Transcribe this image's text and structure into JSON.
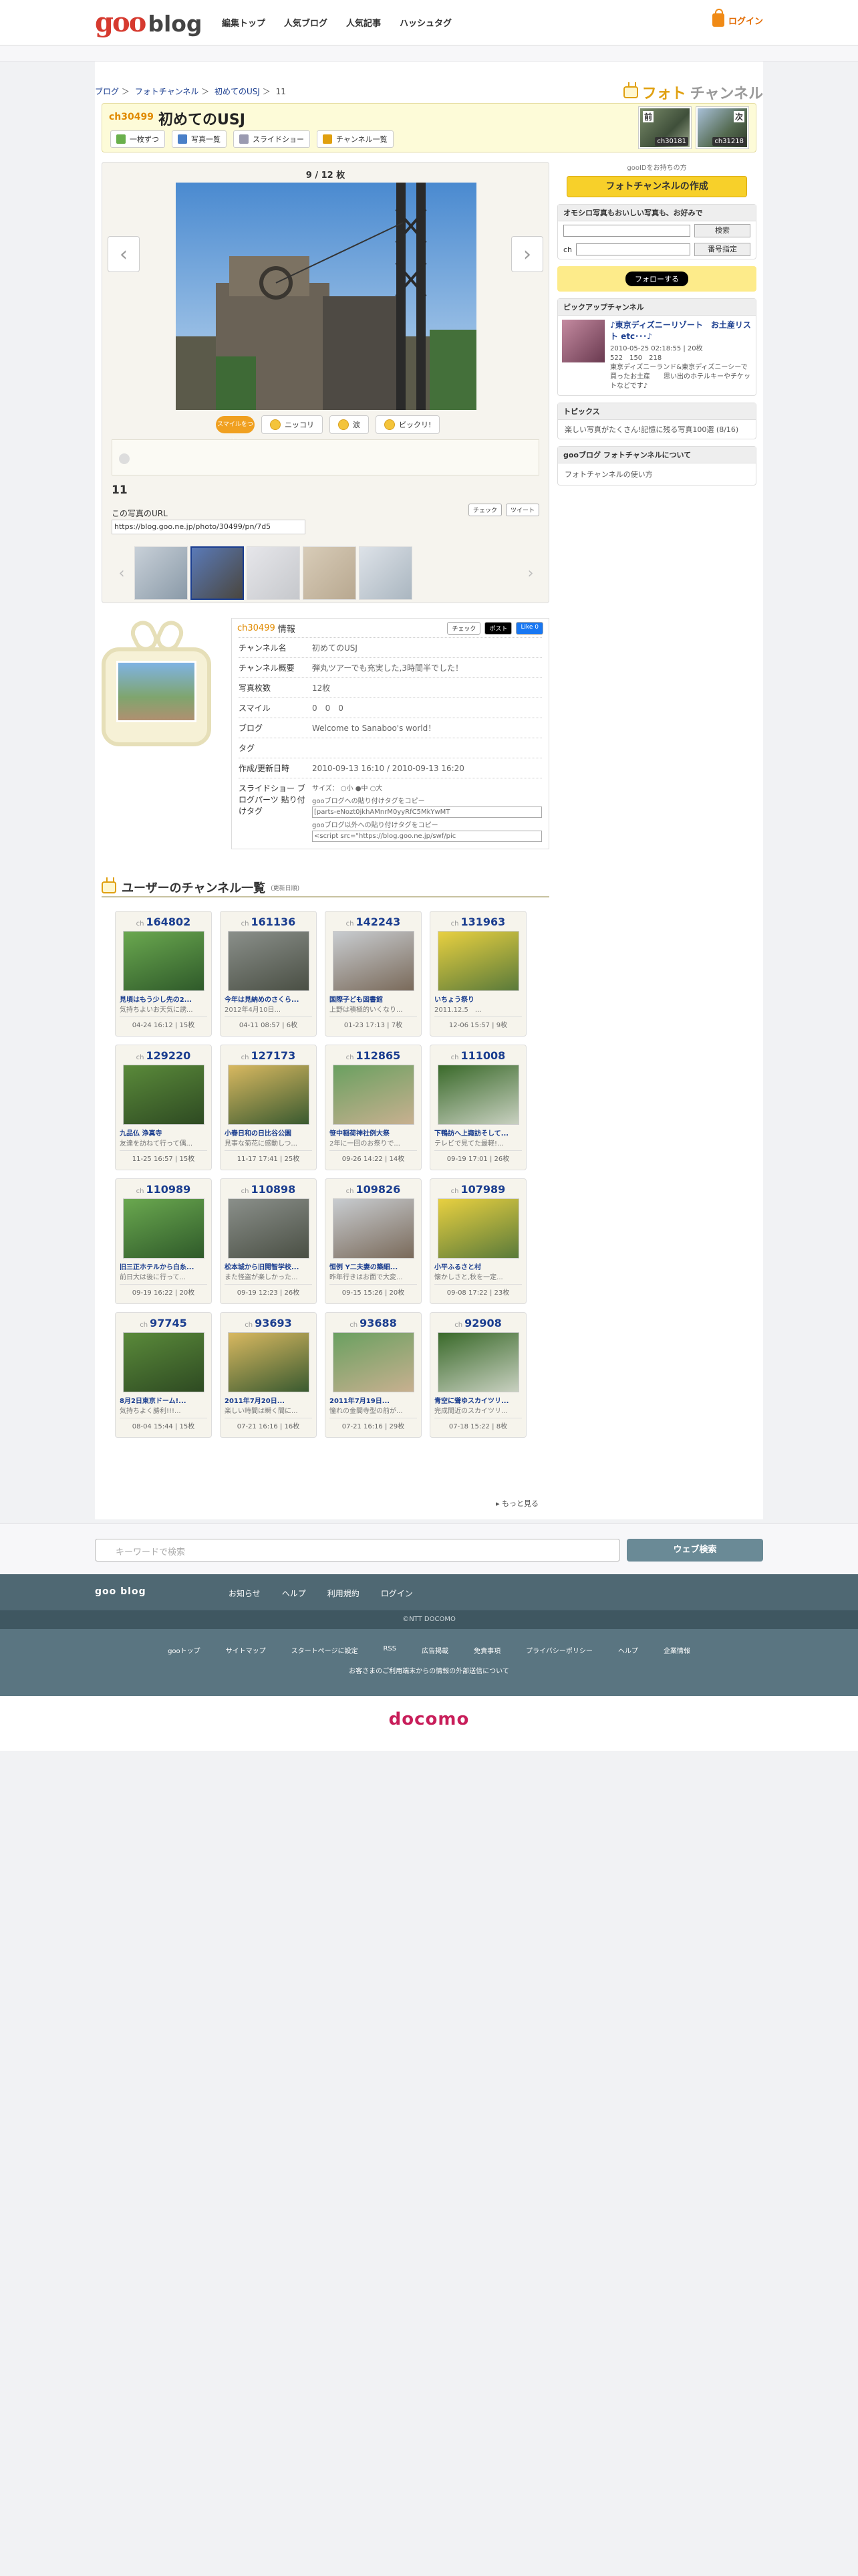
{
  "header": {
    "logo_goo": "goo",
    "logo_blog": "blog",
    "nav": [
      "編集トップ",
      "人気ブログ",
      "人気記事",
      "ハッシュタグ"
    ],
    "login": "ログイン"
  },
  "breadcrumb": [
    "ブログ",
    "＞",
    "フォトチャンネル",
    "＞",
    "初めてのUSJ",
    "＞",
    "11"
  ],
  "brand": {
    "photo": "フォト",
    "channel": "チャンネル"
  },
  "channel": {
    "id": "ch30499",
    "title": "初めてのUSJ",
    "buttons": [
      "一枚ずつ",
      "写真一覧",
      "スライドショー",
      "チャンネル一覧"
    ],
    "prev": {
      "dir": "前",
      "id": "ch30181"
    },
    "next": {
      "dir": "次",
      "id": "ch31218"
    }
  },
  "viewer": {
    "counter": "9 / 12 枚",
    "smile_badge": "スマイルをつける",
    "smiles": [
      "ニッコリ",
      "涙",
      "ビックリ!"
    ],
    "photo_name": "11",
    "url_label": "この写真のURL",
    "url": "https://blog.goo.ne.jp/photo/30499/pn/7d5",
    "share": [
      "チェック",
      "ツイート"
    ]
  },
  "sidebar": {
    "gooid": "gooIDをお持ちの方",
    "create": "フォトチャンネルの作成",
    "search_title": "オモシロ写真もおいしい写真も、お好みで",
    "search_btn": "検索",
    "ch_label": "ch",
    "ch_btn": "番号指定",
    "follow": "フォローする",
    "pickup_title": "ピックアップチャンネル",
    "pickup": {
      "title": "♪東京ディズニーリゾート　お土産リスト etc･･･♪",
      "meta": "2010-05-25 02:18:55 | 20枚",
      "counts": "522　150　218",
      "desc": "東京ディズニーランド&東京ディズニーシーで買ったお土産　　思い出のホテルキーやチケットなどです♪"
    },
    "topics_title": "トピックス",
    "topic": "楽しい写真がたくさん!記憶に残る写真100選",
    "topic_date": "(8/16)",
    "about_title": "gooブログ フォトチャンネルについて",
    "about": "フォトチャンネルの使い方"
  },
  "info": {
    "channel": "ch30499",
    "label": "情報",
    "share": [
      "チェック",
      "ポスト",
      "Like 0"
    ],
    "rows": [
      [
        "チャンネル名",
        "初めてのUSJ"
      ],
      [
        "チャンネル概要",
        "弾丸ツアーでも充実した,3時間半でした！"
      ],
      [
        "写真枚数",
        "12枚"
      ],
      [
        "スマイル",
        "0　0　0"
      ],
      [
        "ブログ",
        "Welcome to Sanaboo's world！"
      ],
      [
        "タグ",
        ""
      ],
      [
        "作成/更新日時",
        "2010-09-13 16:10 / 2010-09-13 16:20"
      ]
    ],
    "parts_label": "スライドショー ブログパーツ 貼り付けタグ",
    "size": "サイズ：",
    "sizes": [
      "小",
      "中",
      "大"
    ],
    "copy1": "gooブログへの貼り付けタグをコピー",
    "code1": "[parts-eNozt0jkhAMnrM0yyRfC5MkYwMT",
    "copy2": "gooブログ以外への貼り付けタグをコピー",
    "code2": "<script src=\"https://blog.goo.ne.jp/swf/pic"
  },
  "user_channels": {
    "title": "ユーザーのチャンネル一覧",
    "sub": "(更新日順)",
    "more": "もっと見る",
    "items": [
      {
        "ch": "164802",
        "title": "見頃はもう少し先の2...",
        "desc": "気持ちよいお天気に誘...",
        "meta": "04-24 16:12 | 15枚"
      },
      {
        "ch": "161136",
        "title": "今年は見納めのさくら...",
        "desc": "2012年4月10日...",
        "meta": "04-11 08:57 | 6枚"
      },
      {
        "ch": "142243",
        "title": "国際子ども図書館",
        "desc": "上野は積極的いくなり...",
        "meta": "01-23 17:13 | 7枚"
      },
      {
        "ch": "131963",
        "title": "いちょう祭り",
        "desc": "2011.12.5　...",
        "meta": "12-06 15:57 | 9枚"
      },
      {
        "ch": "129220",
        "title": "九品仏 浄真寺",
        "desc": "友達を訪ねて行って偶...",
        "meta": "11-25 16:57 | 15枚"
      },
      {
        "ch": "127173",
        "title": "小春日和の日比谷公園",
        "desc": "見事な菊花に感動しつ...",
        "meta": "11-17 17:41 | 25枚"
      },
      {
        "ch": "112865",
        "title": "笹中稲荷神社例大祭",
        "desc": "2年に一回のお祭りで...",
        "meta": "09-26 14:22 | 14枚"
      },
      {
        "ch": "111008",
        "title": "下鴨訪へ上諏訪そして...",
        "desc": "テレビで見てた最軽!...",
        "meta": "09-19 17:01 | 26枚"
      },
      {
        "ch": "110989",
        "title": "旧三正ホテルから白糸...",
        "desc": "前日大は後に行って...",
        "meta": "09-19 16:22 | 20枚"
      },
      {
        "ch": "110898",
        "title": "松本城から旧開智学校...",
        "desc": "また怪盗が楽しかった...",
        "meta": "09-19 12:23 | 26枚"
      },
      {
        "ch": "109826",
        "title": "恒例 Y二夫妻の築細...",
        "desc": "昨年行きはお面で大変...",
        "meta": "09-15 15:26 | 20枚"
      },
      {
        "ch": "107989",
        "title": "小平ふるさと村",
        "desc": "懐かしさと,秋を一定...",
        "meta": "09-08 17:22 | 23枚"
      },
      {
        "ch": "97745",
        "title": "8月2日東京ドーム!...",
        "desc": "気持ちよく勝利!!!...",
        "meta": "08-04 15:44 | 15枚"
      },
      {
        "ch": "93693",
        "title": "2011年7月20日...",
        "desc": "楽しい時間は瞬く間に...",
        "meta": "07-21 16:16 | 16枚"
      },
      {
        "ch": "93688",
        "title": "2011年7月19日...",
        "desc": "憧れの金閣寺型の前が...",
        "meta": "07-21 16:16 | 29枚"
      },
      {
        "ch": "92908",
        "title": "青空に聳ゆスカイツリ...",
        "desc": "完成間近のスカイツリ...",
        "meta": "07-18 15:22 | 8枚"
      }
    ]
  },
  "search": {
    "placeholder": "キーワードで検索",
    "button": "ウェブ検索"
  },
  "footer": {
    "brand": "goo blog",
    "links": [
      "お知らせ",
      "ヘルプ",
      "利用規約",
      "ログイン"
    ],
    "copyright": "©NTT DOCOMO",
    "links2": [
      "gooトップ",
      "サイトマップ",
      "スタートページに設定",
      "RSS",
      "広告掲載",
      "免責事項",
      "プライバシーポリシー",
      "ヘルプ",
      "企業情報"
    ],
    "notice": "お客さまのご利用端末からの情報の外部送信について",
    "docomo": "docomo"
  }
}
